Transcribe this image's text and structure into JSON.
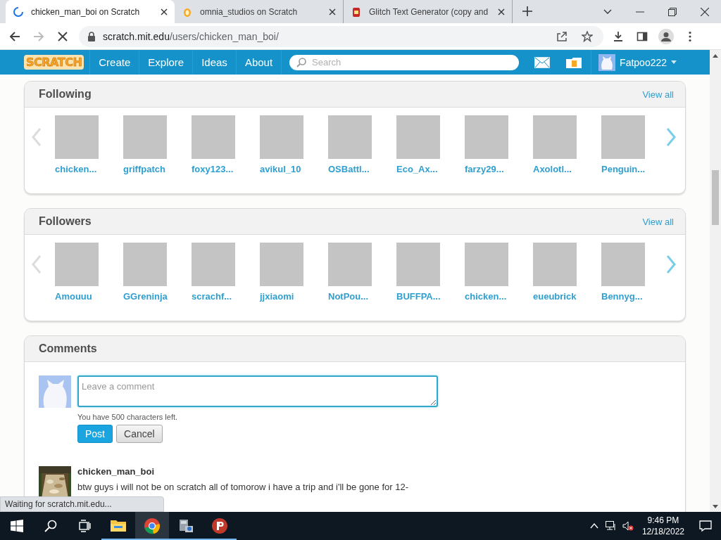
{
  "browser": {
    "tabs": [
      {
        "title": "chicken_man_boi on Scratch",
        "kind": "loading",
        "selected": true
      },
      {
        "title": "omnia_studios on Scratch",
        "kind": "scratch",
        "selected": false
      },
      {
        "title": "Glitch Text Generator (copy and",
        "kind": "glitch",
        "selected": false
      }
    ],
    "forward_disabled": true,
    "loading": true,
    "url": {
      "host": "scratch.mit.edu",
      "path": "/users/chicken_man_boi/"
    },
    "status": "Waiting for scratch.mit.edu..."
  },
  "navbar": {
    "logo": "SCRATCH",
    "links": [
      "Create",
      "Explore",
      "Ideas",
      "About"
    ],
    "search": {
      "placeholder": "Search"
    },
    "username": "Fatpoo222"
  },
  "sections": [
    {
      "title": "Following",
      "view_all": "View all",
      "prev_disabled": true,
      "next_disabled": false,
      "users": [
        "chicken...",
        "griffpatch",
        "foxy123...",
        "avikul_10",
        "OSBattl...",
        "Eco_Ax...",
        "farzy29...",
        "Axolotl...",
        "Penguin..."
      ]
    },
    {
      "title": "Followers",
      "view_all": "View all",
      "prev_disabled": true,
      "next_disabled": false,
      "users": [
        "Amouuu",
        "GGreninja",
        "scrachf...",
        "jjxiaomi",
        "NotPou...",
        "BUFFPA...",
        "chicken...",
        "eueubrick",
        "Bennyg..."
      ]
    }
  ],
  "comments": {
    "title": "Comments",
    "field": {
      "placeholder": "Leave a comment"
    },
    "counter": "You have 500 characters left.",
    "post": "Post",
    "cancel": "Cancel",
    "items": [
      {
        "user": "chicken_man_boi",
        "text": "btw guys i will not be on scratch all of tomorow i have a trip and i'll be gone for 12-"
      }
    ]
  },
  "taskbar": {
    "apps": [
      {
        "kind": "explorer",
        "selected": false
      },
      {
        "kind": "chrome",
        "selected": true
      },
      {
        "kind": "installer",
        "selected": false
      },
      {
        "kind": "vpn",
        "selected": false
      }
    ],
    "time": "9:46 PM",
    "date": "12/18/2022"
  }
}
